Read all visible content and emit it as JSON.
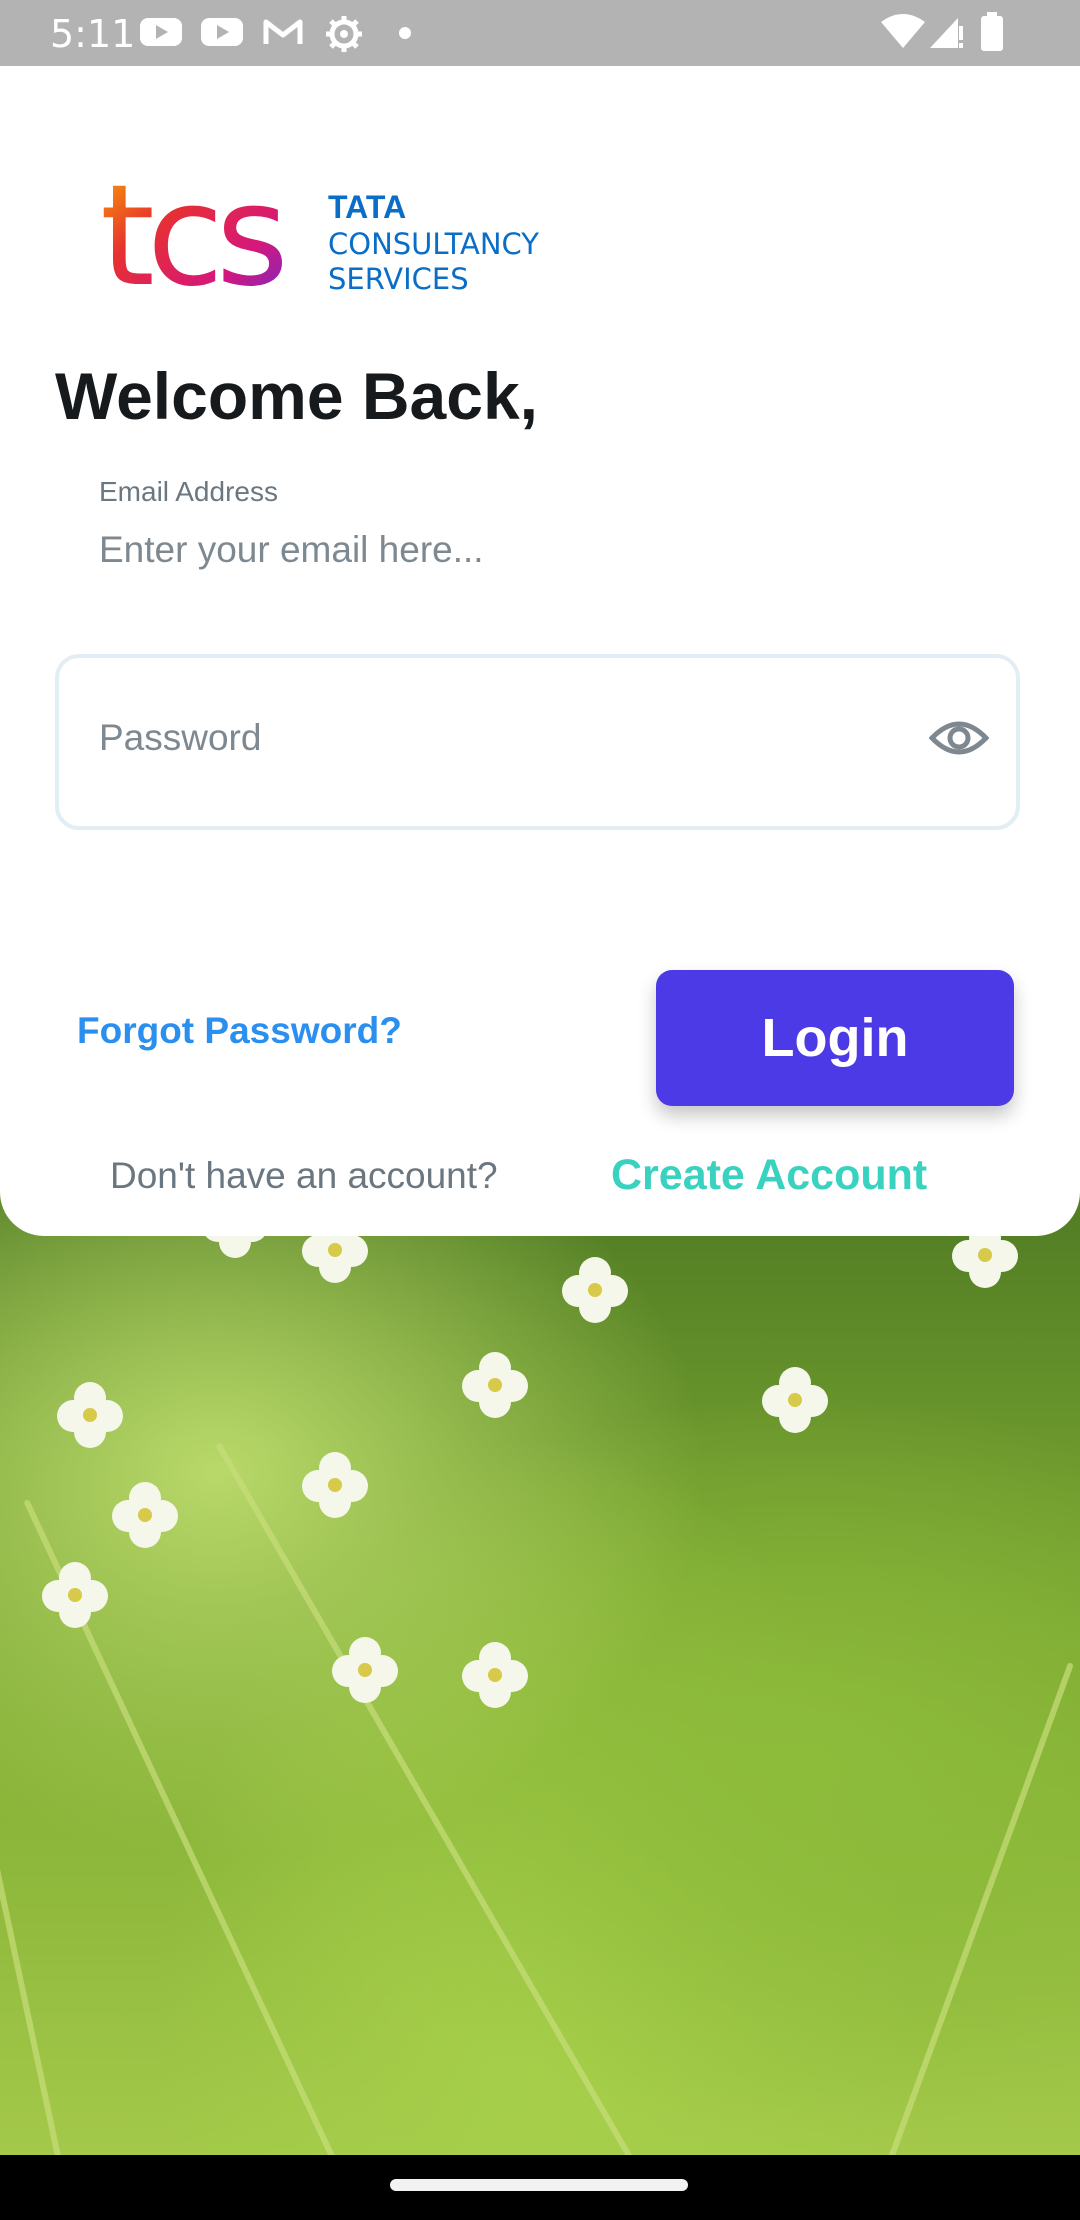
{
  "status_bar": {
    "time": "5:11",
    "left_icons": [
      "youtube-icon",
      "youtube-icon",
      "gmail-icon",
      "settings-icon",
      "dot-icon"
    ],
    "right_icons": [
      "wifi-icon",
      "signal-icon",
      "battery-icon"
    ]
  },
  "logo": {
    "mark": "tcs",
    "line1": "TATA",
    "line2": "CONSULTANCY",
    "line3": "SERVICES"
  },
  "form": {
    "welcome": "Welcome Back,",
    "email_label": "Email Address",
    "email_placeholder": "Enter your email here...",
    "email_value": "",
    "password_placeholder": "Password",
    "password_value": "",
    "forgot_password": "Forgot Password?",
    "login_label": "Login",
    "no_account_text": "Don't have an account?",
    "create_account": "Create Account"
  },
  "colors": {
    "accent": "#4b3ae6",
    "link_blue": "#2b8ff0",
    "link_teal": "#39d2c0",
    "status_bar": "#b3b3b3"
  }
}
